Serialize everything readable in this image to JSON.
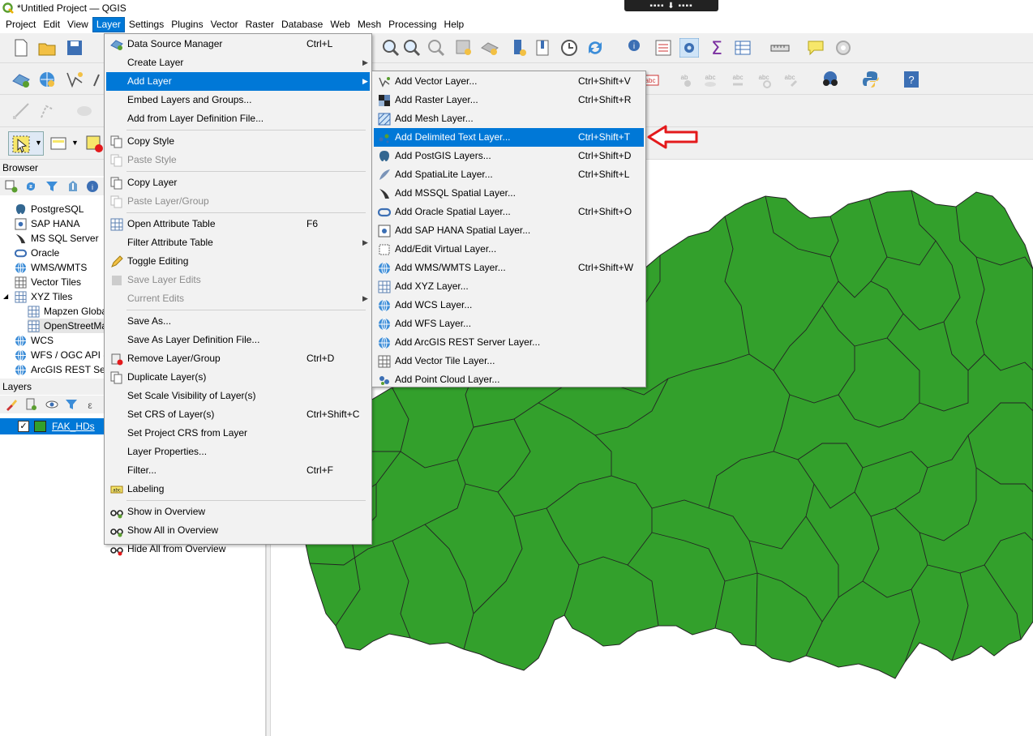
{
  "window": {
    "title": "*Untitled Project — QGIS"
  },
  "menubar": [
    {
      "label": "Project"
    },
    {
      "label": "Edit"
    },
    {
      "label": "View"
    },
    {
      "label": "Layer",
      "active": true
    },
    {
      "label": "Settings"
    },
    {
      "label": "Plugins"
    },
    {
      "label": "Vector"
    },
    {
      "label": "Raster"
    },
    {
      "label": "Database"
    },
    {
      "label": "Web"
    },
    {
      "label": "Mesh"
    },
    {
      "label": "Processing"
    },
    {
      "label": "Help"
    }
  ],
  "browser": {
    "title": "Browser",
    "items": [
      {
        "label": "PostgreSQL",
        "icon": "postgresql-icon"
      },
      {
        "label": "SAP HANA",
        "icon": "sap-hana-icon"
      },
      {
        "label": "MS SQL Server",
        "icon": "mssql-icon"
      },
      {
        "label": "Oracle",
        "icon": "oracle-icon"
      },
      {
        "label": "WMS/WMTS",
        "icon": "wms-icon"
      },
      {
        "label": "Vector Tiles",
        "icon": "vector-tiles-icon"
      },
      {
        "label": "XYZ Tiles",
        "icon": "xyz-tiles-icon"
      },
      {
        "label": "Mapzen Globa",
        "icon": "tile-grid-icon"
      },
      {
        "label": "OpenStreetMa",
        "icon": "tile-grid-icon"
      },
      {
        "label": "WCS",
        "icon": "wcs-icon"
      },
      {
        "label": "WFS / OGC API -",
        "icon": "wfs-icon"
      },
      {
        "label": "ArcGIS REST Serv",
        "icon": "arcgis-icon"
      }
    ]
  },
  "layers": {
    "title": "Layers",
    "items": [
      {
        "label": "FAK_HDs",
        "checked": true,
        "color": "#33a02c"
      }
    ]
  },
  "layer_menu": {
    "items": [
      {
        "label": "Data Source Manager",
        "shortcut": "Ctrl+L",
        "icon": "data-source-manager-icon"
      },
      {
        "label": "Create Layer",
        "submenu": true
      },
      {
        "label": "Add Layer",
        "submenu": true,
        "highlighted": true
      },
      {
        "label": "Embed Layers and Groups..."
      },
      {
        "label": "Add from Layer Definition File..."
      },
      {
        "separator": true
      },
      {
        "label": "Copy Style",
        "icon": "copy-style-icon"
      },
      {
        "label": "Paste Style",
        "disabled": true,
        "icon": "paste-style-icon"
      },
      {
        "separator": true
      },
      {
        "label": "Copy Layer",
        "icon": "copy-layer-icon"
      },
      {
        "label": "Paste Layer/Group",
        "disabled": true,
        "icon": "paste-layer-icon"
      },
      {
        "separator": true
      },
      {
        "label": "Open Attribute Table",
        "shortcut": "F6",
        "icon": "attribute-table-icon"
      },
      {
        "label": "Filter Attribute Table",
        "submenu": true
      },
      {
        "label": "Toggle Editing",
        "icon": "pencil-icon"
      },
      {
        "label": "Save Layer Edits",
        "disabled": true,
        "icon": "save-edits-icon"
      },
      {
        "label": "Current Edits",
        "disabled": true,
        "submenu": true
      },
      {
        "separator": true
      },
      {
        "label": "Save As..."
      },
      {
        "label": "Save As Layer Definition File..."
      },
      {
        "label": "Remove Layer/Group",
        "shortcut": "Ctrl+D",
        "icon": "remove-layer-icon"
      },
      {
        "label": "Duplicate Layer(s)",
        "icon": "duplicate-layer-icon"
      },
      {
        "label": "Set Scale Visibility of Layer(s)"
      },
      {
        "label": "Set CRS of Layer(s)",
        "shortcut": "Ctrl+Shift+C"
      },
      {
        "label": "Set Project CRS from Layer"
      },
      {
        "label": "Layer Properties..."
      },
      {
        "label": "Filter...",
        "shortcut": "Ctrl+F"
      },
      {
        "label": "Labeling",
        "icon": "labeling-icon"
      },
      {
        "separator": true
      },
      {
        "label": "Show in Overview",
        "icon": "show-overview-icon"
      },
      {
        "label": "Show All in Overview",
        "icon": "show-all-overview-icon"
      },
      {
        "label": "Hide All from Overview",
        "icon": "hide-overview-icon"
      }
    ]
  },
  "add_layer_menu": {
    "items": [
      {
        "label": "Add Vector Layer...",
        "shortcut": "Ctrl+Shift+V",
        "icon": "vector-layer-icon"
      },
      {
        "label": "Add Raster Layer...",
        "shortcut": "Ctrl+Shift+R",
        "icon": "raster-layer-icon"
      },
      {
        "label": "Add Mesh Layer...",
        "icon": "mesh-layer-icon"
      },
      {
        "label": "Add Delimited Text Layer...",
        "shortcut": "Ctrl+Shift+T",
        "highlighted": true,
        "icon": "delimited-text-icon"
      },
      {
        "label": "Add PostGIS Layers...",
        "shortcut": "Ctrl+Shift+D",
        "icon": "postgis-icon"
      },
      {
        "label": "Add SpatiaLite Layer...",
        "shortcut": "Ctrl+Shift+L",
        "icon": "spatialite-icon"
      },
      {
        "label": "Add MSSQL Spatial Layer...",
        "icon": "mssql-icon"
      },
      {
        "label": "Add Oracle Spatial Layer...",
        "shortcut": "Ctrl+Shift+O",
        "icon": "oracle-icon"
      },
      {
        "label": "Add SAP HANA Spatial Layer...",
        "icon": "sap-hana-icon"
      },
      {
        "label": "Add/Edit Virtual Layer...",
        "icon": "virtual-layer-icon"
      },
      {
        "label": "Add WMS/WMTS Layer...",
        "shortcut": "Ctrl+Shift+W",
        "icon": "wms-icon"
      },
      {
        "label": "Add XYZ Layer...",
        "icon": "xyz-tiles-icon"
      },
      {
        "label": "Add WCS Layer...",
        "icon": "wcs-icon"
      },
      {
        "label": "Add WFS Layer...",
        "icon": "wfs-icon"
      },
      {
        "label": "Add ArcGIS REST Server Layer...",
        "icon": "arcgis-icon"
      },
      {
        "label": "Add Vector Tile Layer...",
        "icon": "vector-tiles-icon"
      },
      {
        "label": "Add Point Cloud Layer...",
        "icon": "point-cloud-icon"
      }
    ]
  },
  "map": {
    "fill": "#33a02c",
    "stroke": "#232323"
  },
  "colors": {
    "accent": "#0078d7",
    "annotation_arrow": "#e31a1c"
  }
}
